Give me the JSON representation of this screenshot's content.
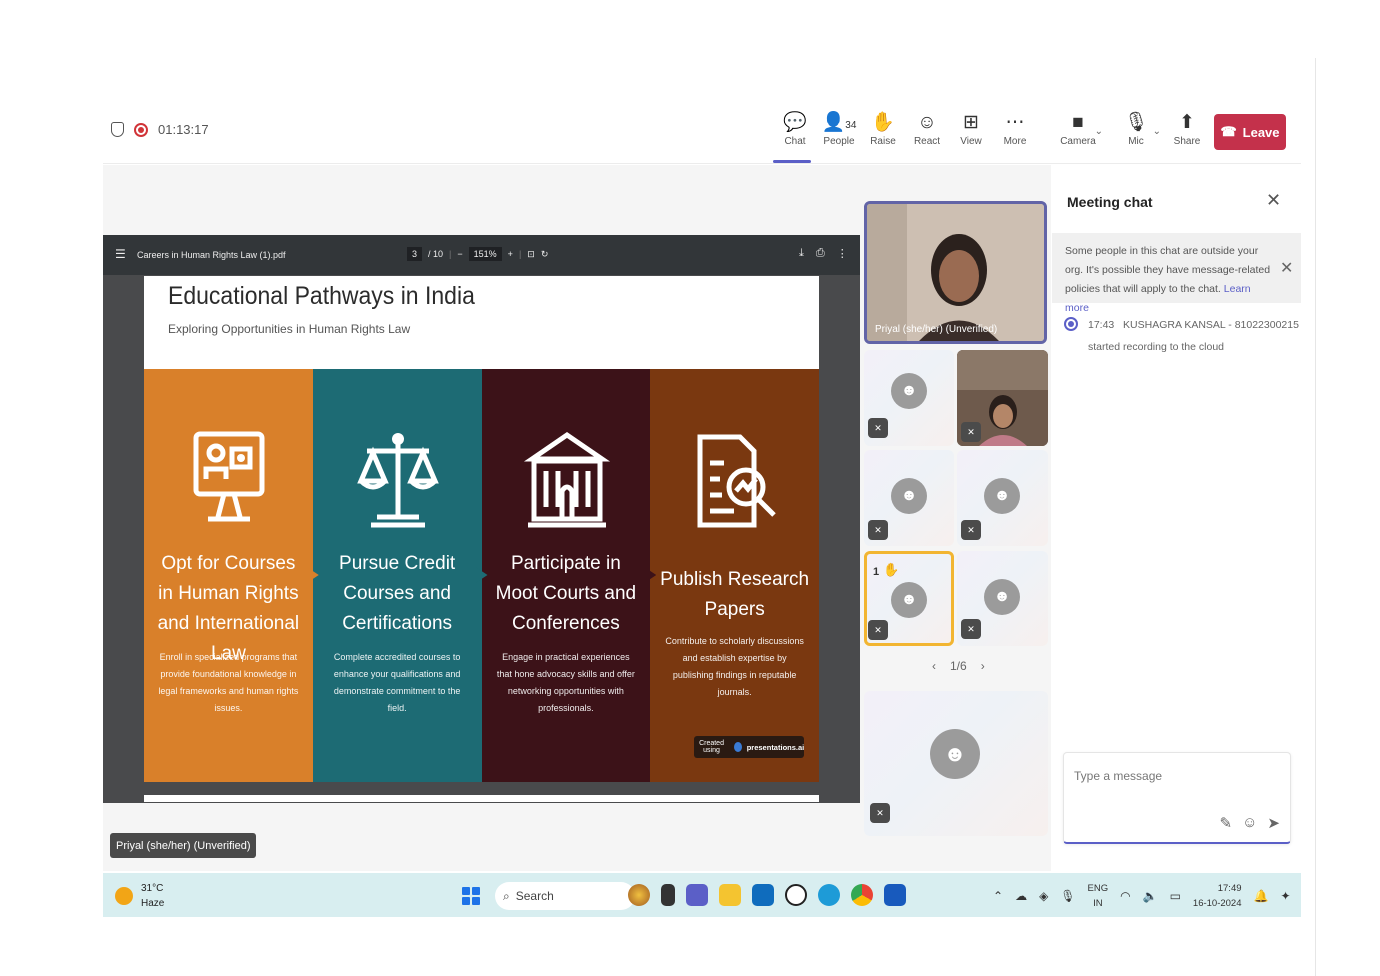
{
  "meeting": {
    "elapsed": "01:13:17"
  },
  "toolbar": {
    "chat": "Chat",
    "people": "People",
    "people_count": "34",
    "raise": "Raise",
    "react": "React",
    "view": "View",
    "more": "More",
    "camera": "Camera",
    "mic": "Mic",
    "share": "Share",
    "leave": "Leave"
  },
  "pdf_viewer": {
    "filename": "Careers in Human Rights Law (1).pdf",
    "page_current": "3",
    "page_total": "/ 10",
    "zoom": "151%"
  },
  "slide": {
    "title": "Educational Pathways in India",
    "subtitle": "Exploring Opportunities in Human Rights Law",
    "columns": [
      {
        "title": "Opt for Courses in Human Rights and International Law",
        "desc": "Enroll in specialized programs that provide foundational knowledge in legal frameworks and human rights issues.",
        "color": "#d9802a",
        "icon": "computer-screen-icon"
      },
      {
        "title": "Pursue Credit Courses and Certifications",
        "desc": "Complete accredited courses to enhance your qualifications and demonstrate commitment to the field.",
        "color": "#1d6b74",
        "icon": "scales-of-justice-icon"
      },
      {
        "title": "Participate in Moot Courts and Conferences",
        "desc": "Engage in practical experiences that hone advocacy skills and offer networking opportunities with professionals.",
        "color": "#3c1218",
        "icon": "courthouse-icon"
      },
      {
        "title": "Publish Research Papers",
        "desc": "Contribute to scholarly discussions and establish expertise by publishing findings in reputable journals.",
        "color": "#7a3810",
        "icon": "document-search-icon"
      }
    ],
    "badge_prefix": "Created using",
    "badge_brand": "presentations.ai"
  },
  "presenter_label": "Priyal (she/her) (Unverified)",
  "participants": {
    "spotlight_name": "Priyal (she/her) (Unverified)",
    "hand_count": "1",
    "page": "1/6"
  },
  "chat": {
    "title": "Meeting chat",
    "notice_text": "Some people in this chat are outside your org. It's possible they have message-related policies that will apply to the chat.",
    "notice_link": "Learn more",
    "system_time": "17:43",
    "system_name": "KUSHAGRA KANSAL - 81022300215",
    "system_action": "started recording to the cloud",
    "placeholder": "Type a message"
  },
  "taskbar": {
    "temp": "31°C",
    "weather": "Haze",
    "search": "Search",
    "lang1": "ENG",
    "lang2": "IN",
    "time": "17:49",
    "date": "16-10-2024"
  }
}
